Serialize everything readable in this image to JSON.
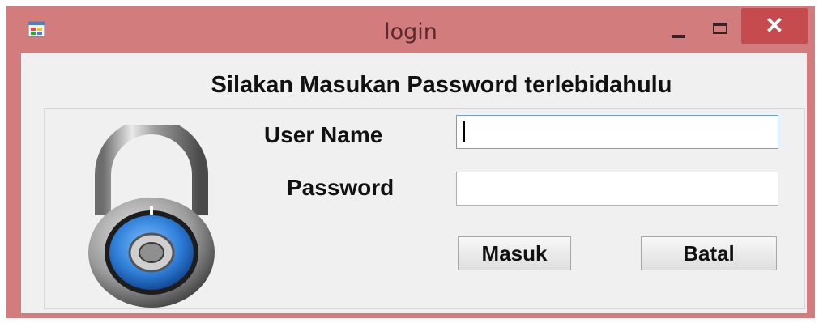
{
  "window": {
    "title": "login",
    "close_glyph": "✕"
  },
  "form": {
    "heading": "Silakan Masukan Password terlebidahulu",
    "username_label": "User Name",
    "password_label": "Password",
    "username_value": "",
    "password_value": "",
    "submit_label": "Masuk",
    "cancel_label": "Batal"
  },
  "icons": {
    "app": "app-window-icon",
    "lock": "padlock-icon"
  },
  "colors": {
    "frame": "#d27c7e",
    "close_button": "#c64b4e",
    "client": "#f0f0f0",
    "lock_dial": "#2f7fd9"
  }
}
